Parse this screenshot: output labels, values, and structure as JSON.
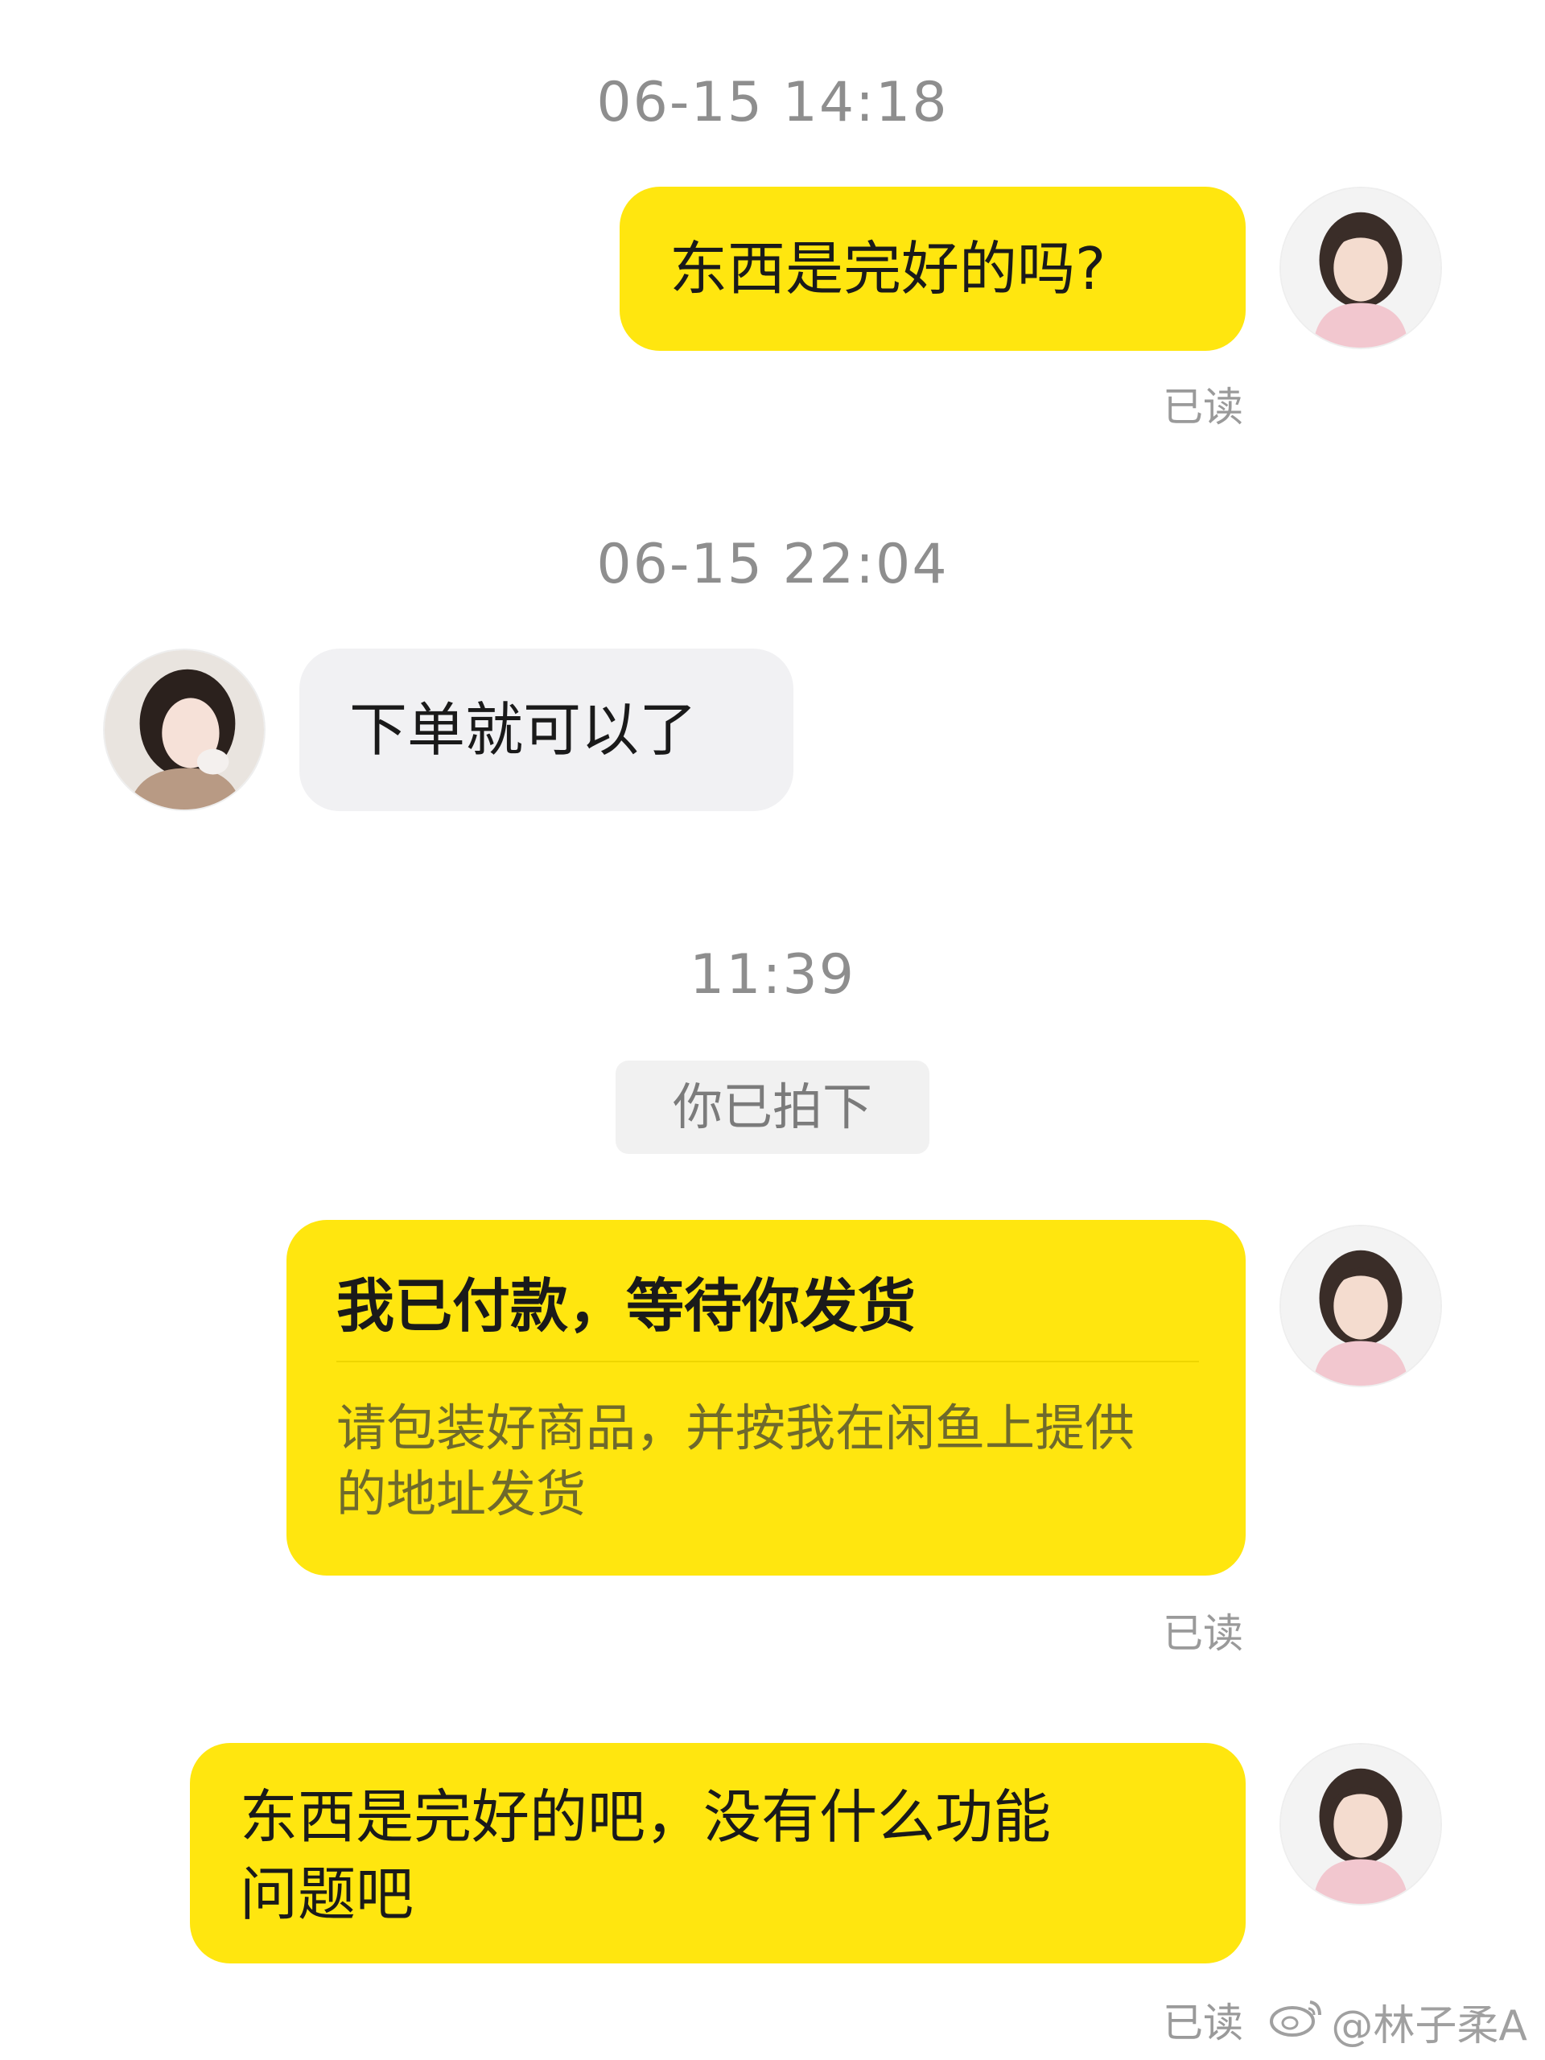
{
  "messages": [
    {
      "timestamp": "06-15 14:18",
      "text": "东西是完好的吗?",
      "read_status": "已读"
    },
    {
      "timestamp": "06-15 22:04",
      "text": "下单就可以了"
    },
    {
      "timestamp": "11:39",
      "system_notice": "你已拍下"
    },
    {
      "card_title": "我已付款，等待你发货",
      "card_description": "请包装好商品，并按我在闲鱼上提供的地址发货",
      "read_status": "已读"
    },
    {
      "text_line1": "东西是完好的吧，没有什么功能",
      "text_line2": "问题吧",
      "read_status": "已读"
    }
  ],
  "watermark": {
    "handle": "@林子柔A",
    "icon": "weibo-icon"
  },
  "colors": {
    "my_bubble": "#ffe60f",
    "their_bubble": "#f1f1f3",
    "timestamp": "#8e8e8e"
  }
}
